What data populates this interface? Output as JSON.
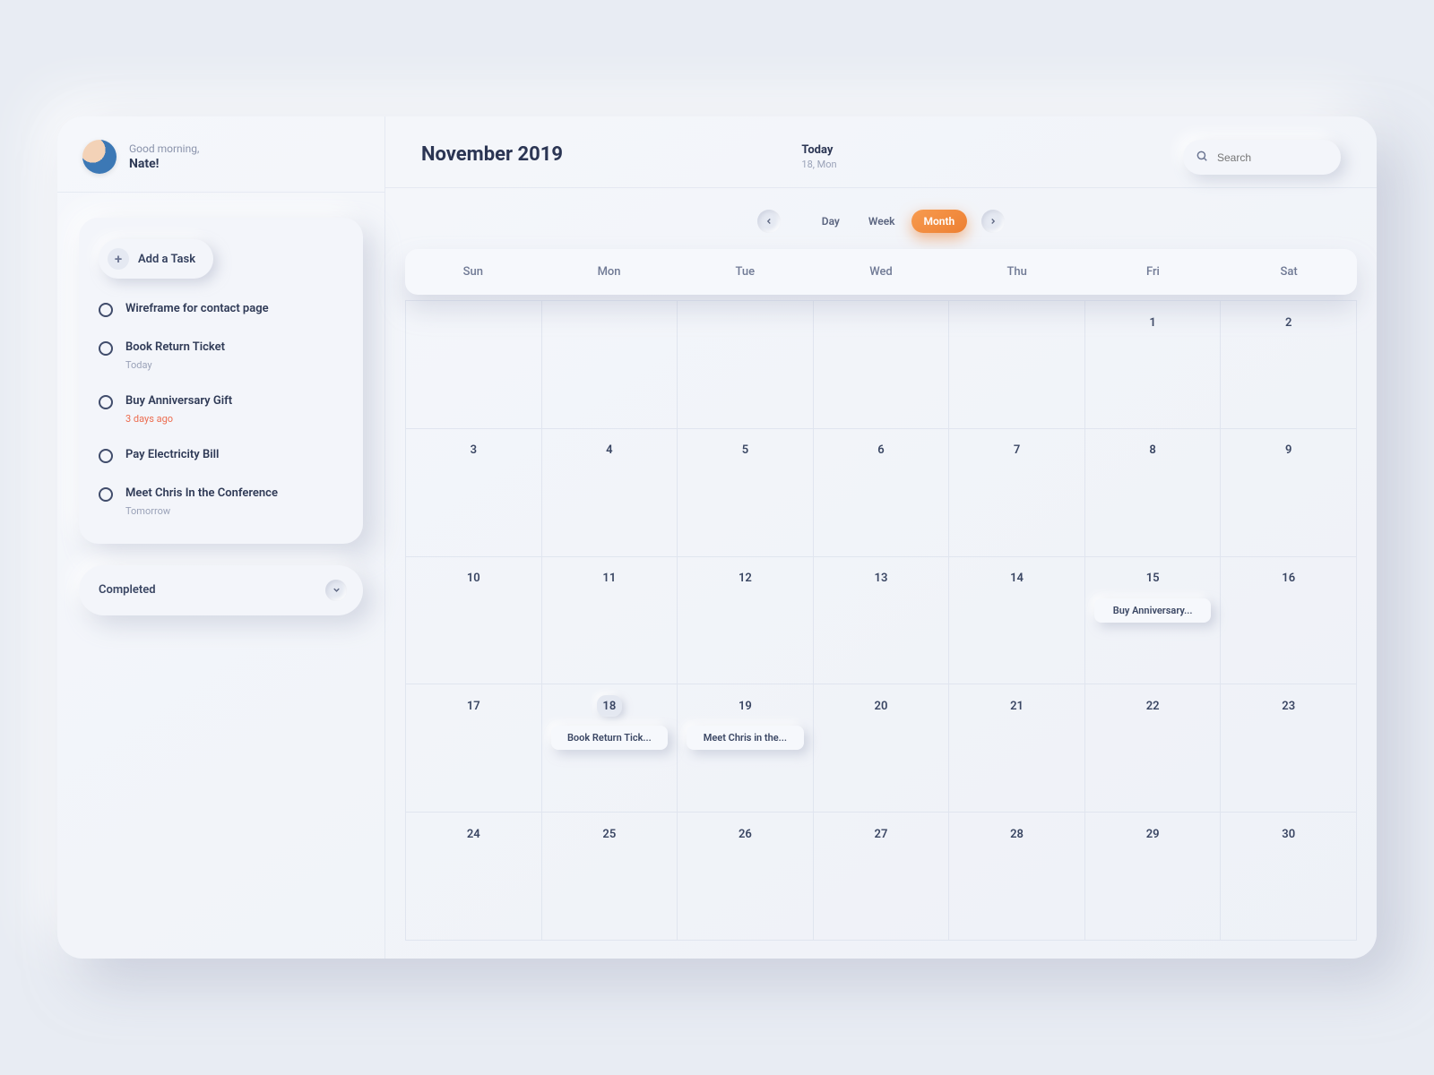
{
  "profile": {
    "greeting": "Good morning,",
    "name": "Nate!"
  },
  "sidebar": {
    "add_task_label": "Add a Task",
    "tasks": [
      {
        "title": "Wireframe for contact page",
        "sub": "",
        "overdue": false
      },
      {
        "title": "Book Return Ticket",
        "sub": "Today",
        "overdue": false
      },
      {
        "title": "Buy Anniversary Gift",
        "sub": "3 days ago",
        "overdue": true
      },
      {
        "title": "Pay Electricity Bill",
        "sub": "",
        "overdue": false
      },
      {
        "title": "Meet Chris In the Conference",
        "sub": "Tomorrow",
        "overdue": false
      }
    ],
    "completed_label": "Completed"
  },
  "header": {
    "month_title": "November 2019",
    "today_label": "Today",
    "today_date": "18, Mon",
    "search_placeholder": "Search",
    "views": {
      "day": "Day",
      "week": "Week",
      "month": "Month",
      "active": "month"
    }
  },
  "calendar": {
    "dow": [
      "Sun",
      "Mon",
      "Tue",
      "Wed",
      "Thu",
      "Fri",
      "Sat"
    ],
    "weeks": [
      [
        null,
        null,
        null,
        null,
        null,
        1,
        2
      ],
      [
        3,
        4,
        5,
        6,
        7,
        8,
        9
      ],
      [
        10,
        11,
        12,
        13,
        14,
        15,
        16
      ],
      [
        17,
        18,
        19,
        20,
        21,
        22,
        23
      ],
      [
        24,
        25,
        26,
        27,
        28,
        29,
        30
      ]
    ],
    "today": 18,
    "events": {
      "15": "Buy Anniversary...",
      "18": "Book Return Tick...",
      "19": "Meet Chris in the..."
    }
  },
  "colors": {
    "accent_orange": "#ed7f32",
    "text_primary": "#2f3a56",
    "text_muted": "#8a93ab",
    "overdue": "#ec6b4e"
  }
}
